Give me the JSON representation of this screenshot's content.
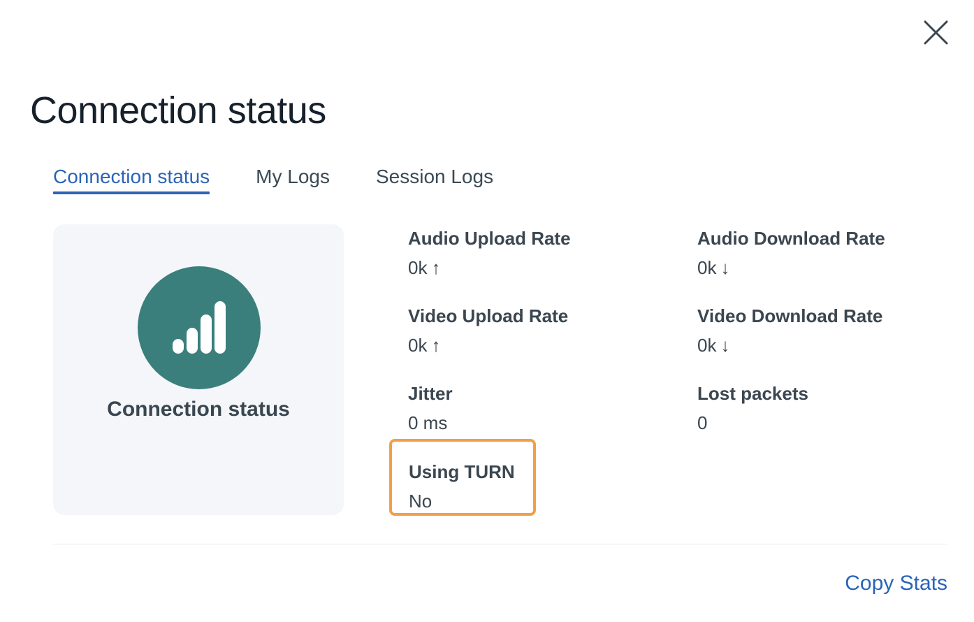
{
  "dialog": {
    "title": "Connection status",
    "close_icon": "close-icon"
  },
  "tabs": [
    {
      "label": "Connection status",
      "active": true
    },
    {
      "label": "My Logs",
      "active": false
    },
    {
      "label": "Session Logs",
      "active": false
    }
  ],
  "status_card": {
    "icon": "signal-bars-icon",
    "label": "Connection status",
    "circle_color": "#3a7f7c"
  },
  "stats": {
    "audio_upload": {
      "label": "Audio Upload Rate",
      "value": "0k",
      "arrow": "↑"
    },
    "audio_download": {
      "label": "Audio Download Rate",
      "value": "0k",
      "arrow": "↓"
    },
    "video_upload": {
      "label": "Video Upload Rate",
      "value": "0k",
      "arrow": "↑"
    },
    "video_download": {
      "label": "Video Download Rate",
      "value": "0k",
      "arrow": "↓"
    },
    "jitter": {
      "label": "Jitter",
      "value": "0 ms"
    },
    "lost_packets": {
      "label": "Lost packets",
      "value": "0"
    },
    "using_turn": {
      "label": "Using TURN",
      "value": "No"
    }
  },
  "highlight": {
    "color": "#f0a04b"
  },
  "footer": {
    "copy_stats_label": "Copy Stats"
  },
  "colors": {
    "accent": "#2a63b8",
    "card_background": "#f4f6f9"
  }
}
